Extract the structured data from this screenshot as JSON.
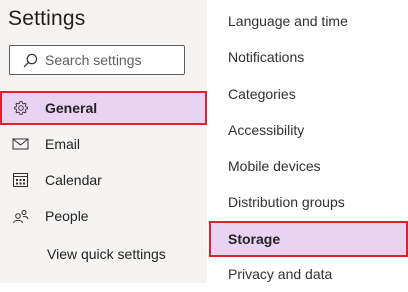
{
  "title": "Settings",
  "search": {
    "placeholder": "Search settings",
    "value": ""
  },
  "nav": [
    {
      "label": "General",
      "icon": "gear-icon",
      "selected": true
    },
    {
      "label": "Email",
      "icon": "mail-icon",
      "selected": false
    },
    {
      "label": "Calendar",
      "icon": "calendar-icon",
      "selected": false
    },
    {
      "label": "People",
      "icon": "people-icon",
      "selected": false
    }
  ],
  "quick_settings_label": "View quick settings",
  "general_subnav": [
    {
      "label": "Language and time",
      "selected": false
    },
    {
      "label": "Notifications",
      "selected": false
    },
    {
      "label": "Categories",
      "selected": false
    },
    {
      "label": "Accessibility",
      "selected": false
    },
    {
      "label": "Mobile devices",
      "selected": false
    },
    {
      "label": "Distribution groups",
      "selected": false
    },
    {
      "label": "Storage",
      "selected": true
    },
    {
      "label": "Privacy and data",
      "selected": false
    }
  ],
  "colors": {
    "selected_background": "#e8d3f2",
    "highlight_border": "#e3202b",
    "left_pane_background": "#f5f4f3"
  }
}
